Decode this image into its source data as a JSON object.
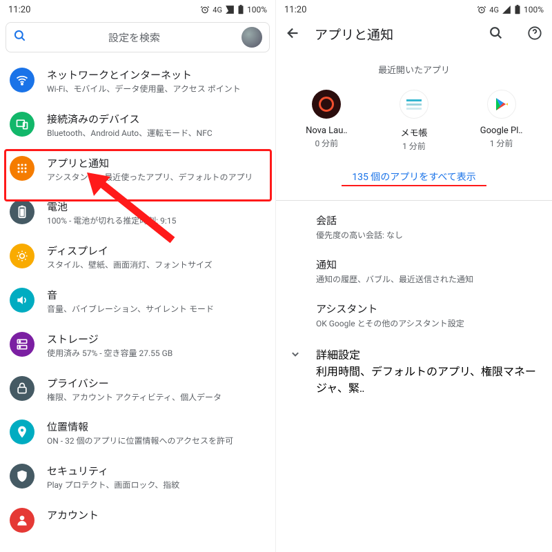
{
  "status": {
    "time": "11:20",
    "net": "4G",
    "battery": "100%"
  },
  "left": {
    "search_placeholder": "設定を検索",
    "items": [
      {
        "title": "ネットワークとインターネット",
        "subtitle": "Wi-Fi、モバイル、データ使用量、アクセス ポイント",
        "icon": "wifi",
        "color": "#1a73e8"
      },
      {
        "title": "接続済みのデバイス",
        "subtitle": "Bluetooth、Android Auto、運転モード、NFC",
        "icon": "devices",
        "color": "#12b76a"
      },
      {
        "title": "アプリと通知",
        "subtitle": "アシスタント、最近使ったアプリ、デフォルトのアプリ",
        "icon": "apps",
        "color": "#f57c00"
      },
      {
        "title": "電池",
        "subtitle": "100% - 電池が切れる推定時刻: 9:15",
        "icon": "battery",
        "color": "#455a64"
      },
      {
        "title": "ディスプレイ",
        "subtitle": "スタイル、壁紙、画面消灯、フォントサイズ",
        "icon": "display",
        "color": "#f9ab00"
      },
      {
        "title": "音",
        "subtitle": "音量、バイブレーション、サイレント モード",
        "icon": "sound",
        "color": "#00acc1"
      },
      {
        "title": "ストレージ",
        "subtitle": "使用済み 57% - 空き容量 27.55 GB",
        "icon": "storage",
        "color": "#7b1fa2"
      },
      {
        "title": "プライバシー",
        "subtitle": "権限、アカウント アクティビティ、個人データ",
        "icon": "privacy",
        "color": "#455a64"
      },
      {
        "title": "位置情報",
        "subtitle": "ON - 32 個のアプリに位置情報へのアクセスを許可",
        "icon": "location",
        "color": "#00acc1"
      },
      {
        "title": "セキュリティ",
        "subtitle": "Play プロテクト、画面ロック、指紋",
        "icon": "security",
        "color": "#455a64"
      },
      {
        "title": "アカウント",
        "subtitle": "",
        "icon": "account",
        "color": "#e53935"
      }
    ]
  },
  "right": {
    "title": "アプリと通知",
    "section_label": "最近開いたアプリ",
    "recent": [
      {
        "name": "Nova Lau‥",
        "time": "0 分前",
        "bg": "#2b0d0d",
        "fg": "#f14f2e",
        "shape": "ring"
      },
      {
        "name": "メモ帳",
        "time": "1 分前",
        "bg": "#ffffff",
        "fg": "#35b7d1",
        "shape": "lines"
      },
      {
        "name": "Google Pl‥",
        "time": "1 分前",
        "bg": "#ffffff",
        "fg": "",
        "shape": "play"
      }
    ],
    "show_all": "135 個のアプリをすべて表示",
    "rows": [
      {
        "title": "会話",
        "subtitle": "優先度の高い会話: なし"
      },
      {
        "title": "通知",
        "subtitle": "通知の履歴、バブル、最近送信された通知"
      },
      {
        "title": "アシスタント",
        "subtitle": "OK Google とその他のアシスタント設定"
      }
    ],
    "advanced": {
      "title": "詳細設定",
      "subtitle": "利用時間、デフォルトのアプリ、権限マネージャ、緊‥"
    }
  }
}
